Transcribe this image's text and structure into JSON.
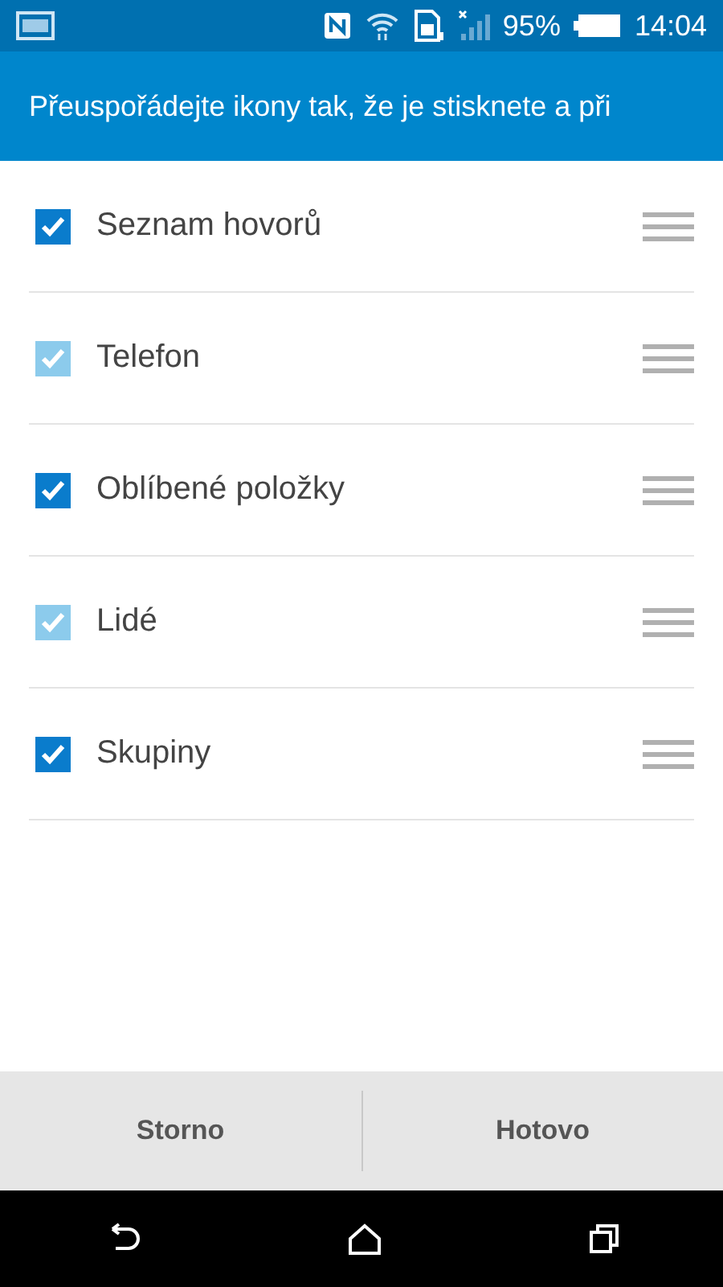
{
  "status_bar": {
    "battery": "95%",
    "time": "14:04"
  },
  "header": {
    "title": "Přeuspořádejte ikony tak, že je stisknete a při"
  },
  "items": [
    {
      "label": "Seznam hovorů",
      "checked": true,
      "disabled": false
    },
    {
      "label": "Telefon",
      "checked": true,
      "disabled": true
    },
    {
      "label": "Oblíbené položky",
      "checked": true,
      "disabled": false
    },
    {
      "label": "Lidé",
      "checked": true,
      "disabled": true
    },
    {
      "label": "Skupiny",
      "checked": true,
      "disabled": false
    }
  ],
  "buttons": [
    "Storno",
    "Hotovo"
  ]
}
